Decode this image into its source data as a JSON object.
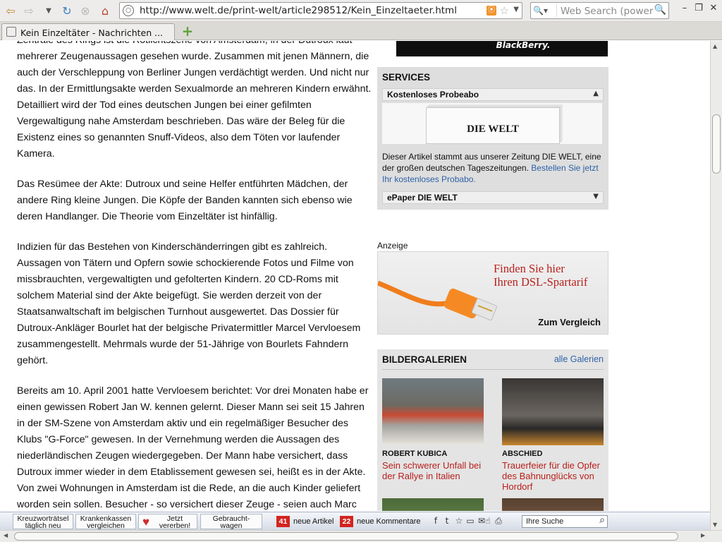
{
  "browser": {
    "url": "http://www.welt.de/print-welt/article298512/Kein_Einzeltaeter.html",
    "search_placeholder": "Web Search (powered",
    "tab_title": "Kein Einzeltäter - Nachrichten ..."
  },
  "article": {
    "paragraphs": [
      "Zentrale des Rings ist die Rotlichtszene von Amsterdam, in der Dutroux laut mehrerer Zeugenaussagen gesehen wurde. Zusammen mit jenen Männern, die auch der Verschleppung von Berliner Jungen verdächtigt werden. Und nicht nur das. In der Ermittlungsakte werden Sexualmorde an mehreren Kindern erwähnt. Detailliert wird der Tod eines deutschen Jungen bei einer gefilmten Vergewaltigung nahe Amsterdam beschrieben. Das wäre der Beleg für die Existenz eines so genannten Snuff-Videos, also dem Töten vor laufender Kamera.",
      "Das Resümee der Akte: Dutroux und seine Helfer entführten Mädchen, der andere Ring kleine Jungen. Die Köpfe der Banden kannten sich ebenso wie deren Handlanger. Die Theorie vom Einzeltäter ist hinfällig.",
      "Indizien für das Bestehen von Kinderschänderringen gibt es zahlreich. Aussagen von Tätern und Opfern sowie schockierende Fotos und Filme von missbrauchten, vergewaltigten und gefolterten Kindern. 20 CD-Roms mit solchem Material sind der Akte beigefügt. Sie werden derzeit von der Staatsanwaltschaft im belgischen Turnhout ausgewertet. Das Dossier für Dutroux-Ankläger Bourlet hat der belgische Privatermittler Marcel Vervloesem zusammengestellt. Mehrmals wurde der 51-Jährige von Bourlets Fahndern gehört.",
      "Bereits am 10. April 2001 hatte Vervloesem berichtet: Vor drei Monaten habe er einen gewissen Robert Jan W. kennen gelernt. Dieser Mann sei seit 15 Jahren in der SM-Szene von Amsterdam aktiv und ein regelmäßiger Besucher des Klubs \"G-Force\" gewesen. In der Vernehmung werden die Aussagen des niederländischen Zeugen wiedergegeben. Der Mann habe versichert, dass Dutroux immer wieder in dem Etablissement gewesen sei, heißt es in der Akte. Von zwei Wohnungen in Amsterdam ist die Rede, an die auch Kinder geliefert worden sein sollen. Besucher - so versichert dieser Zeuge - seien auch Marc"
    ]
  },
  "sidebar": {
    "blackberry_ad": "BlackBerry.",
    "services": {
      "heading": "SERVICES",
      "accordion_1": "Kostenloses Probeabo",
      "paper_logo": "DIE WELT",
      "description": "Dieser Artikel stammt aus unserer Zeitung DIE WELT, eine der großen deutschen Tageszeitungen.",
      "link": "Bestellen Sie jetzt Ihr kostenloses Probabo.",
      "accordion_2": "ePaper DIE WELT"
    },
    "ad_label": "Anzeige",
    "dsl_ad": {
      "line1": "Finden Sie hier",
      "line2": "Ihren DSL-Spartarif",
      "cta": "Zum Vergleich"
    },
    "gallery": {
      "heading": "BILDERGALERIEN",
      "all_link": "alle Galerien",
      "items": [
        {
          "kicker": "ROBERT KUBICA",
          "title": "Sein schwerer Unfall bei der Rallye in Italien"
        },
        {
          "kicker": "ABSCHIED",
          "title": "Trauerfeier für die Opfer des Bahnunglücks von Hordorf"
        }
      ]
    }
  },
  "welt_toolbar": {
    "btn1": [
      "Kreuzworträtsel",
      "täglich neu"
    ],
    "btn2": [
      "Krankenkassen",
      "vergleichen"
    ],
    "btn3": [
      "Jetzt",
      "vererben!"
    ],
    "btn4": [
      "Gebraucht-",
      "wagen"
    ],
    "new_articles_count": "41",
    "new_articles_label": "neue Artikel",
    "new_comments_count": "22",
    "new_comments_label": "neue Kommentare",
    "search_placeholder": "Ihre Suche"
  }
}
